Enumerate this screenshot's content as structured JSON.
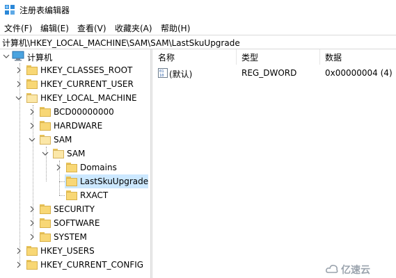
{
  "window": {
    "title": "注册表编辑器"
  },
  "menu": [
    "文件(F)",
    "编辑(E)",
    "查看(V)",
    "收藏夹(A)",
    "帮助(H)"
  ],
  "address": "计算机\\HKEY_LOCAL_MACHINE\\SAM\\SAM\\LastSkuUpgrade",
  "tree": {
    "root": "计算机",
    "hkcr": "HKEY_CLASSES_ROOT",
    "hkcu": "HKEY_CURRENT_USER",
    "hklm": "HKEY_LOCAL_MACHINE",
    "bcd": "BCD00000000",
    "hardware": "HARDWARE",
    "sam": "SAM",
    "sam_sam": "SAM",
    "domains": "Domains",
    "lastsku": "LastSkuUpgrade",
    "rxact": "RXACT",
    "security": "SECURITY",
    "software": "SOFTWARE",
    "system": "SYSTEM",
    "hku": "HKEY_USERS",
    "hkcc": "HKEY_CURRENT_CONFIG"
  },
  "columns": {
    "name": "名称",
    "type": "类型",
    "data": "数据"
  },
  "values": [
    {
      "name": "(默认)",
      "type": "REG_DWORD",
      "data": "0x00000004 (4)",
      "icon": "dword-value-icon"
    }
  ],
  "watermark": {
    "text": "亿速云"
  },
  "colors": {
    "selection": "#cce8ff",
    "folder": "#f8d775",
    "accent": "#0078d7"
  }
}
